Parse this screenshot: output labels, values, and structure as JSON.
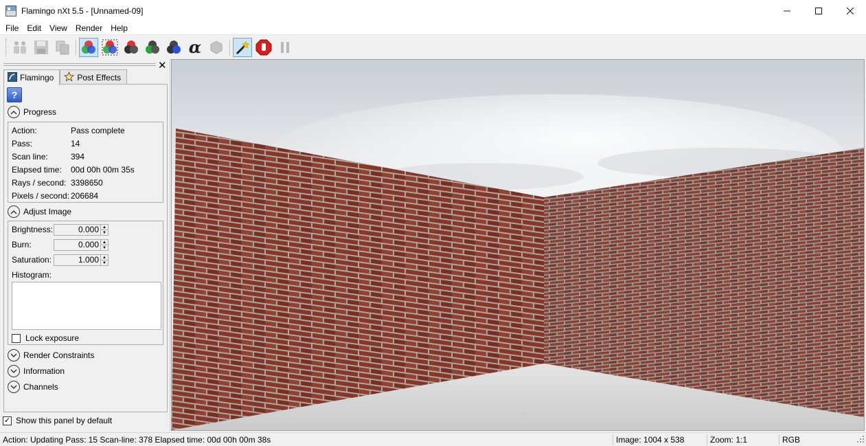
{
  "window": {
    "title": "Flamingo nXt 5.5 - [Unnamed-09]",
    "minimize": "—",
    "maximize": "☐",
    "close": "✕"
  },
  "menu": {
    "file": "File",
    "edit": "Edit",
    "view": "View",
    "render": "Render",
    "help": "Help"
  },
  "toolbar": {
    "icons": [
      "people-icon",
      "save-icon",
      "copy-icon",
      "rgb-channels-icon",
      "rgb-channels-alt-icon",
      "red-channel-icon",
      "green-channel-icon",
      "blue-channel-icon",
      "alpha-channel-icon",
      "hexagon-icon",
      "magic-wand-icon",
      "stop-icon",
      "pause-icon"
    ],
    "alpha_glyph": "α"
  },
  "panel": {
    "close": "✕",
    "tabs": [
      {
        "label": "Flamingo",
        "icon": "flamingo-icon"
      },
      {
        "label": "Post Effects",
        "icon": "star-icon"
      }
    ],
    "help_glyph": "?",
    "progress": {
      "title": "Progress",
      "rows": [
        {
          "label": "Action:",
          "value": "Pass complete"
        },
        {
          "label": "Pass:",
          "value": "14"
        },
        {
          "label": "Scan line:",
          "value": "394"
        },
        {
          "label": "Elapsed time:",
          "value": "00d 00h 00m 35s"
        },
        {
          "label": "Rays / second:",
          "value": "3398650"
        },
        {
          "label": "Pixels / second:",
          "value": "206684"
        }
      ]
    },
    "adjust_image": {
      "title": "Adjust Image",
      "brightness_label": "Brightness:",
      "brightness_value": "0.000",
      "burn_label": "Burn:",
      "burn_value": "0.000",
      "saturation_label": "Saturation:",
      "saturation_value": "1.000",
      "histogram_label": "Histogram:",
      "lock_exposure_label": "Lock exposure",
      "lock_exposure_checked": false
    },
    "collapsed_sections": [
      "Render Constraints",
      "Information",
      "Channels"
    ],
    "show_by_default_label": "Show this panel by default",
    "show_by_default_checked": true
  },
  "status": {
    "action": "Action: Updating Pass: 15 Scan-line: 378 Elapsed time: 00d 00h 00m 38s",
    "image": "Image: 1004 x 538",
    "zoom": "Zoom: 1:1",
    "mode": "RGB"
  },
  "colors": {
    "brick": "#8e3a2c",
    "mortar": "#bcb4ab",
    "floor": "#dcdcdc",
    "sky": "#eef0f2",
    "active_button": "#cce4f7"
  }
}
